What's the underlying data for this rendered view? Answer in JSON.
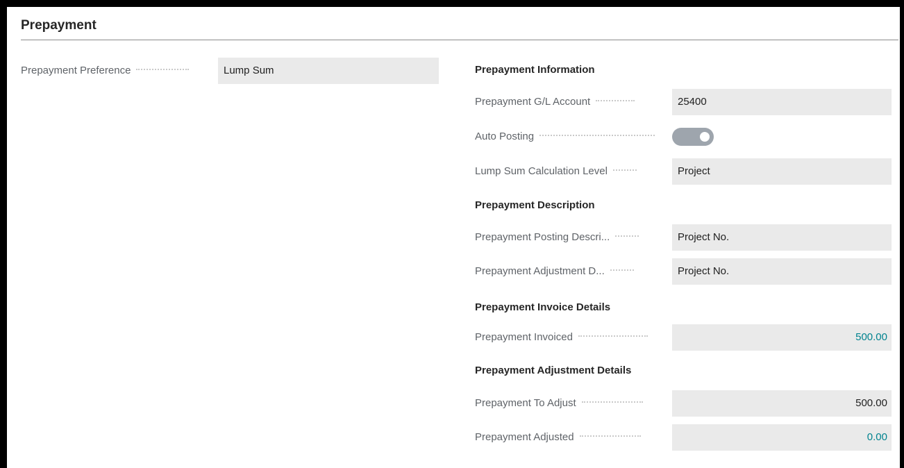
{
  "section": {
    "title": "Prepayment"
  },
  "left": {
    "preference_label": "Prepayment Preference",
    "preference_value": "Lump Sum"
  },
  "info": {
    "heading": "Prepayment Information",
    "gl_account_label": "Prepayment  G/L Account",
    "gl_account_value": "25400",
    "auto_posting_label": "Auto Posting",
    "auto_posting_on": true,
    "calc_level_label": "Lump Sum Calculation Level",
    "calc_level_value": "Project"
  },
  "description": {
    "heading": "Prepayment Description",
    "posting_label": "Prepayment Posting Descri...",
    "posting_value": "Project No.",
    "adjustment_label": "Prepayment Adjustment D...",
    "adjustment_value": "Project No."
  },
  "invoice": {
    "heading": "Prepayment Invoice Details",
    "invoiced_label": "Prepayment Invoiced",
    "invoiced_value": "500.00"
  },
  "adjustment": {
    "heading": "Prepayment Adjustment Details",
    "to_adjust_label": "Prepayment To Adjust",
    "to_adjust_value": "500.00",
    "adjusted_label": "Prepayment Adjusted",
    "adjusted_value": "0.00"
  },
  "colors": {
    "link": "#00838f",
    "field_bg": "#eaeaea",
    "toggle": "#9ea5ad"
  }
}
